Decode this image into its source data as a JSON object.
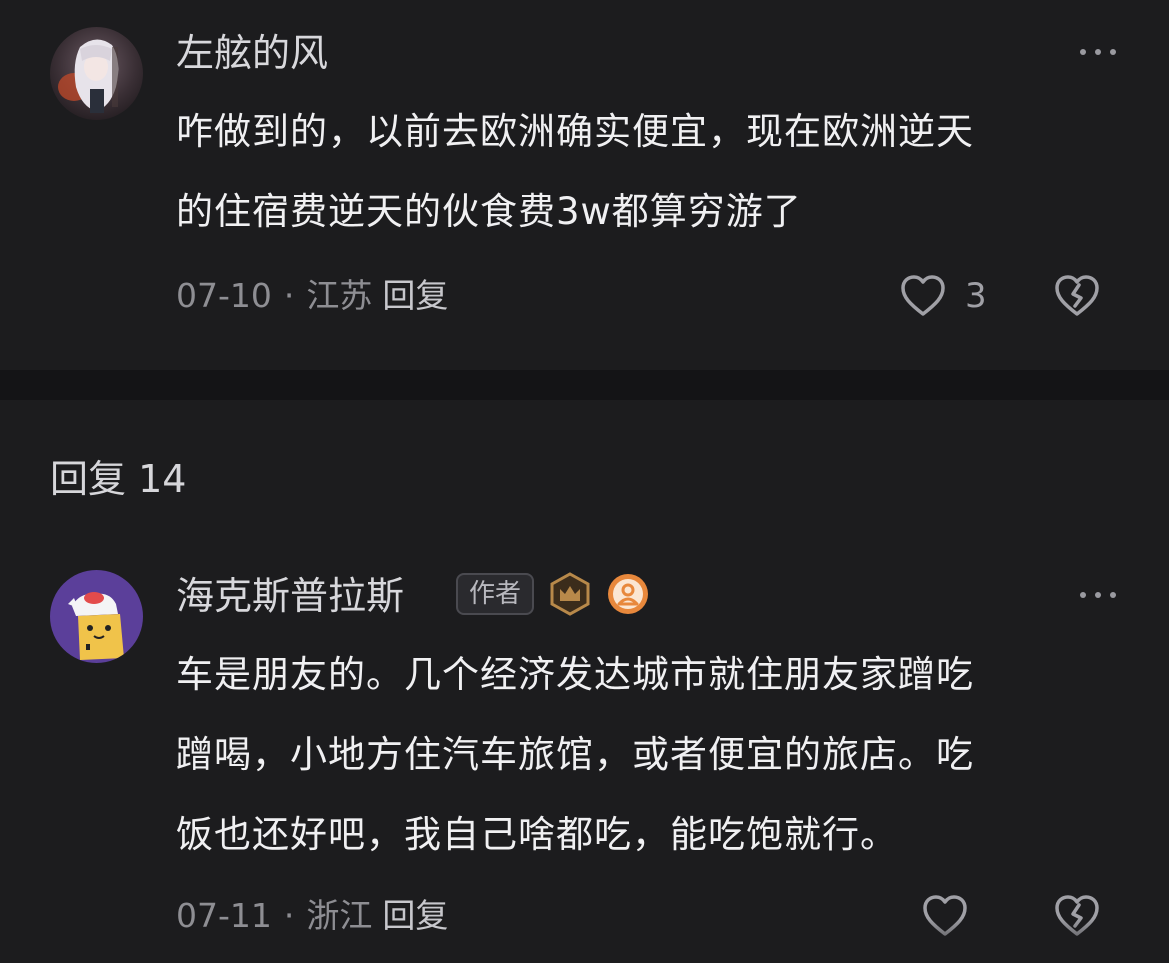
{
  "comment1": {
    "username": "左舷的风",
    "lines": [
      "咋做到的，以前去欧洲确实便宜，现在欧洲逆天",
      "的住宿费逆天的伙食费3w都算穷游了"
    ],
    "date": "07-10",
    "location": "江苏",
    "reply_label": "回复",
    "like_count": "3"
  },
  "replies": {
    "header": "回复 14"
  },
  "comment2": {
    "username": "海克斯普拉斯",
    "author_badge": "作者",
    "lines": [
      "车是朋友的。几个经济发达城市就住朋友家蹭吃",
      "蹭喝，小地方住汽车旅馆，或者便宜的旅店。吃",
      "饭也还好吧，我自己啥都吃，能吃饱就行。"
    ],
    "date": "07-11",
    "location": "浙江",
    "reply_label": "回复"
  },
  "icons": {
    "more": "more-horizontal-icon",
    "like": "heart-icon",
    "dislike": "broken-heart-icon",
    "crown": "crown-badge-icon",
    "person": "person-badge-icon"
  },
  "colors": {
    "background": "#1c1c1e",
    "divider": "#141416",
    "text_primary": "#f0f0f2",
    "text_secondary": "#8e8e93",
    "badge_gold": "#b8894a",
    "badge_orange": "#e8883c"
  }
}
